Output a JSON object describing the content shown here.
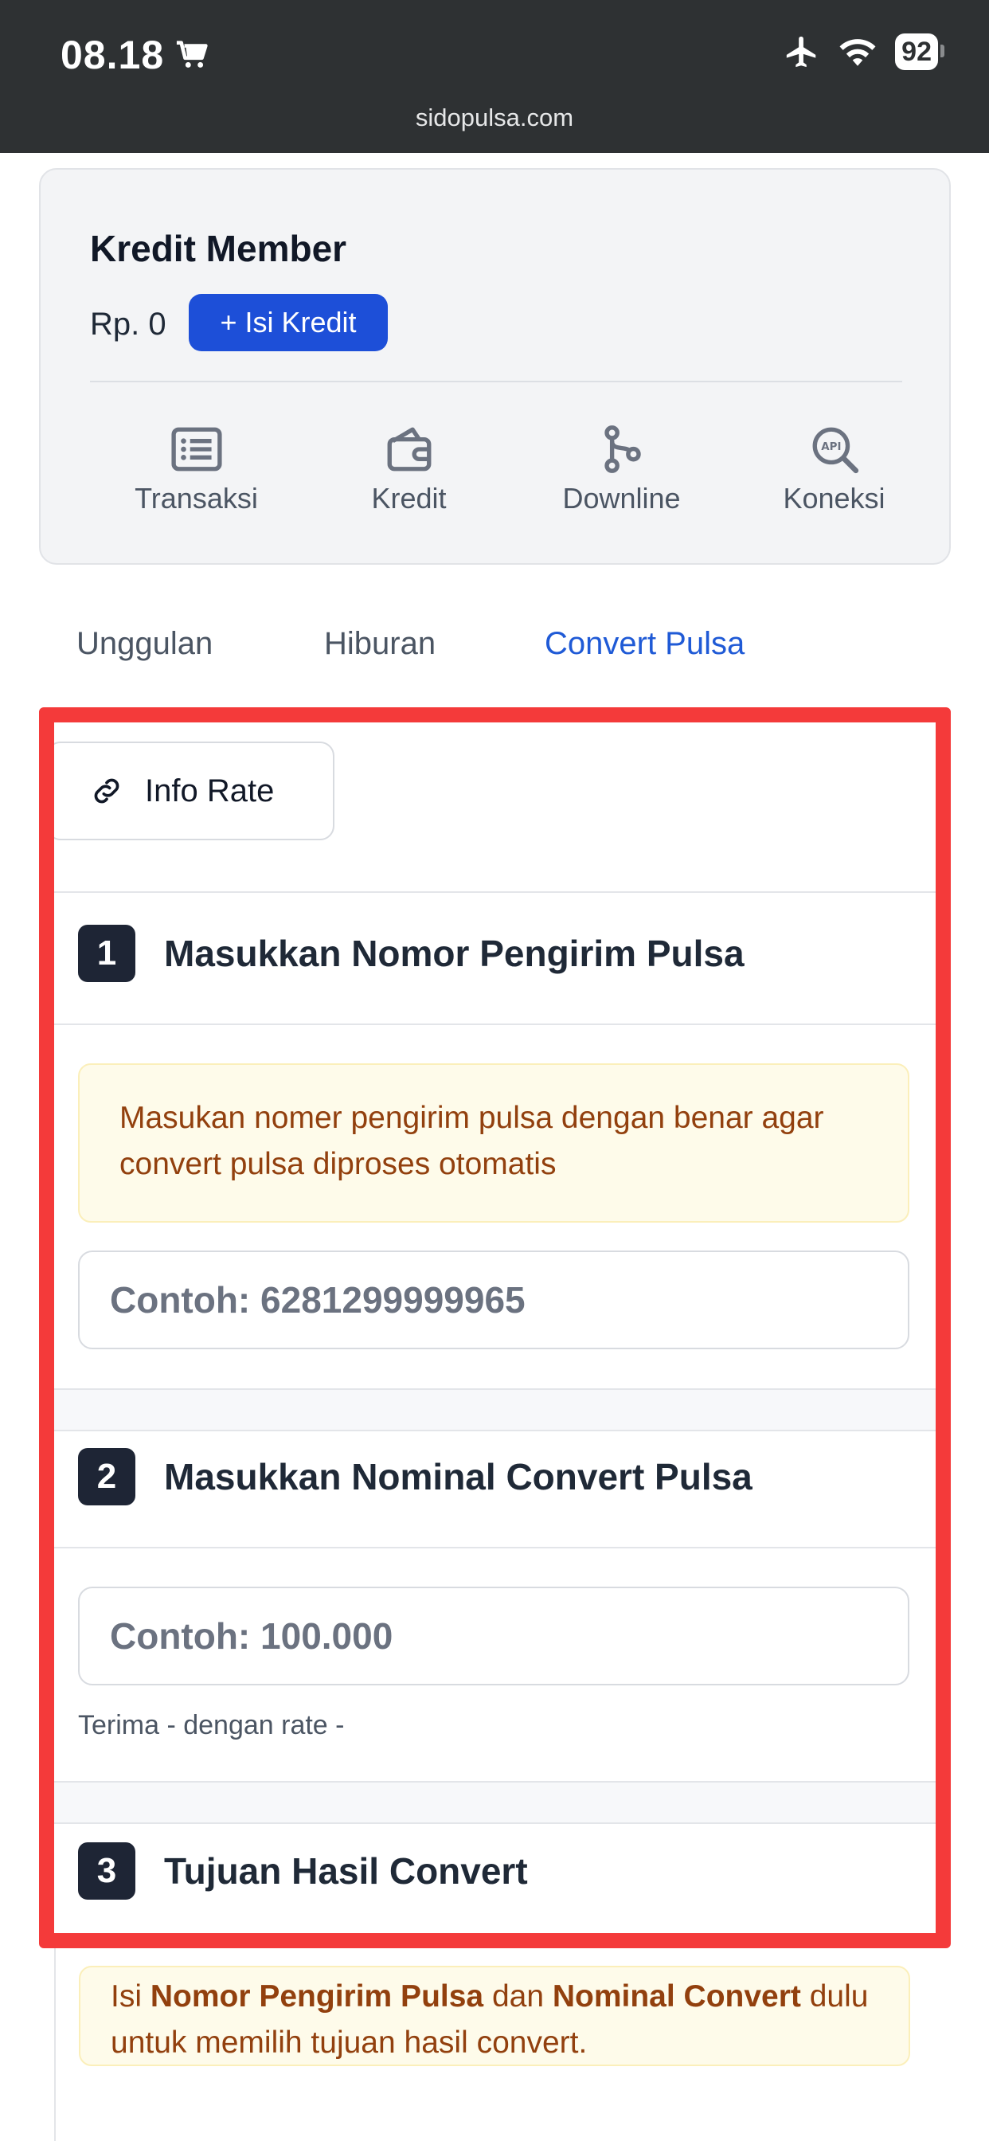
{
  "status_bar": {
    "time": "08.18",
    "battery": "92",
    "url": "sidopulsa.com"
  },
  "member": {
    "title": "Kredit Member",
    "balance": "Rp. 0",
    "topup_button": "+ Isi Kredit",
    "shortcuts": [
      {
        "label": "Transaksi",
        "icon": "list-icon"
      },
      {
        "label": "Kredit",
        "icon": "wallet-icon"
      },
      {
        "label": "Downline",
        "icon": "branch-icon"
      },
      {
        "label": "Koneksi",
        "icon": "api-search-icon"
      }
    ]
  },
  "tabs": [
    {
      "label": "Unggulan",
      "active": false
    },
    {
      "label": "Hiburan",
      "active": false
    },
    {
      "label": "Convert Pulsa",
      "active": true
    }
  ],
  "convert": {
    "info_rate": "Info Rate",
    "step1": {
      "number": "1",
      "title": "Masukkan Nomor Pengirim Pulsa",
      "notice": "Masukan nomer pengirim pulsa dengan benar agar convert pulsa diproses otomatis",
      "placeholder": "Contoh: 6281299999965"
    },
    "step2": {
      "number": "2",
      "title": "Masukkan Nominal Convert Pulsa",
      "placeholder": "Contoh: 100.000",
      "hint": "Terima - dengan rate -"
    },
    "step3": {
      "number": "3",
      "title": "Tujuan Hasil Convert"
    },
    "bottom_notice": {
      "prefix": "Isi ",
      "bold1": "Nomor Pengirim Pulsa",
      "middle": " dan ",
      "bold2": "Nominal Convert",
      "suffix": " dulu untuk memilih tujuan hasil convert."
    }
  },
  "colors": {
    "accent": "#1d4fd8",
    "highlight_frame": "#f43a3a",
    "notice_bg": "#fefbea",
    "notice_text": "#92400e"
  }
}
